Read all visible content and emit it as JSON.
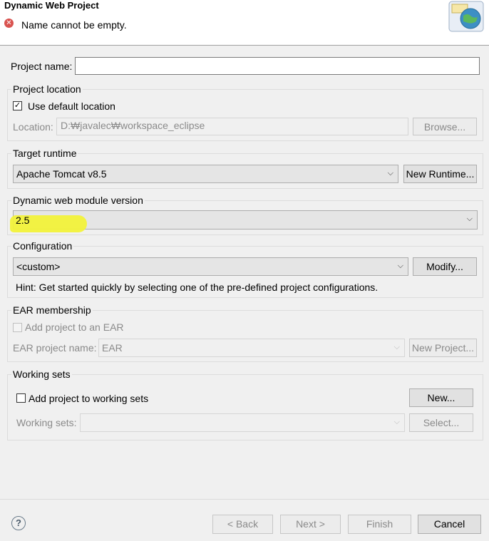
{
  "header": {
    "title": "Dynamic Web Project",
    "error_message": "Name cannot be empty.",
    "error_icon": "error-icon",
    "banner_icon": "web-project-wizard-icon"
  },
  "project_name": {
    "label": "Project name:",
    "value": ""
  },
  "project_location": {
    "title": "Project location",
    "use_default_label": "Use default location",
    "use_default_checked": true,
    "location_label": "Location:",
    "location_value": "D:₩javalec₩workspace_eclipse",
    "browse_label": "Browse..."
  },
  "target_runtime": {
    "title": "Target runtime",
    "selected": "Apache Tomcat v8.5",
    "new_runtime_label": "New Runtime..."
  },
  "web_module": {
    "title": "Dynamic web module version",
    "selected": "2.5",
    "highlight_color": "#f2f23a"
  },
  "configuration": {
    "title": "Configuration",
    "selected": "<custom>",
    "modify_label": "Modify...",
    "hint": "Hint: Get started quickly by selecting one of the pre-defined project configurations."
  },
  "ear": {
    "title": "EAR membership",
    "add_label": "Add project to an EAR",
    "add_checked": false,
    "name_label": "EAR project name:",
    "name_value": "EAR",
    "new_project_label": "New Project..."
  },
  "working_sets": {
    "title": "Working sets",
    "add_label": "Add project to working sets",
    "add_checked": false,
    "new_label": "New...",
    "sets_label": "Working sets:",
    "sets_value": "",
    "select_label": "Select..."
  },
  "footer": {
    "help_icon": "help-icon",
    "back_label": "< Back",
    "next_label": "Next >",
    "finish_label": "Finish",
    "cancel_label": "Cancel"
  }
}
